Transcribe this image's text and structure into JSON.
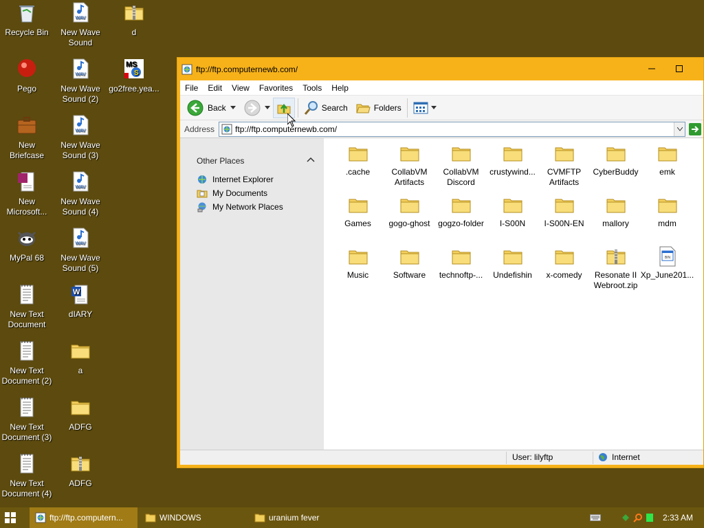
{
  "desktop": {
    "icons": [
      {
        "label": "Recycle Bin",
        "icon": "recycle-bin-icon"
      },
      {
        "label": "New Wave Sound",
        "icon": "wav-file-icon"
      },
      {
        "label": "d",
        "icon": "zip-folder-icon"
      },
      {
        "label": "Pego",
        "icon": "pego-app-icon"
      },
      {
        "label": "New Wave Sound (2)",
        "icon": "wav-file-icon"
      },
      {
        "label": "go2free.yea...",
        "icon": "msn-shortcut-icon"
      },
      {
        "label": "New Briefcase",
        "icon": "briefcase-icon"
      },
      {
        "label": "New Wave Sound (3)",
        "icon": "wav-file-icon"
      },
      {
        "label": "New Microsoft...",
        "icon": "ms-document-icon"
      },
      {
        "label": "New Wave Sound (4)",
        "icon": "wav-file-icon"
      },
      {
        "label": "MyPal 68",
        "icon": "mypal-browser-icon"
      },
      {
        "label": "New Wave Sound (5)",
        "icon": "wav-file-icon"
      },
      {
        "label": "New Text Document",
        "icon": "text-document-icon"
      },
      {
        "label": "dIARY",
        "icon": "word-document-icon"
      },
      {
        "label": "New Text Document (2)",
        "icon": "text-document-icon"
      },
      {
        "label": "a",
        "icon": "folder-icon"
      },
      {
        "label": "New Text Document (3)",
        "icon": "text-document-icon"
      },
      {
        "label": "ADFG",
        "icon": "folder-icon"
      },
      {
        "label": "New Text Document (4)",
        "icon": "text-document-icon"
      },
      {
        "label": "ADFG",
        "icon": "zip-folder-icon"
      }
    ]
  },
  "window": {
    "title": "ftp://ftp.computernewb.com/",
    "menu": [
      "File",
      "Edit",
      "View",
      "Favorites",
      "Tools",
      "Help"
    ],
    "toolbar": {
      "back": "Back",
      "search": "Search",
      "folders": "Folders"
    },
    "address": {
      "label": "Address",
      "value": "ftp://ftp.computernewb.com/"
    },
    "other_places": {
      "title": "Other Places",
      "items": [
        "Internet Explorer",
        "My Documents",
        "My Network Places"
      ]
    },
    "files": [
      {
        "name": ".cache",
        "type": "folder"
      },
      {
        "name": "CollabVM Artifacts",
        "type": "folder"
      },
      {
        "name": "CollabVM Discord",
        "type": "folder"
      },
      {
        "name": "crustywind...",
        "type": "folder"
      },
      {
        "name": "CVMFTP Artifacts",
        "type": "folder"
      },
      {
        "name": "CyberBuddy",
        "type": "folder"
      },
      {
        "name": "emk",
        "type": "folder"
      },
      {
        "name": "Games",
        "type": "folder"
      },
      {
        "name": "gogo-ghost",
        "type": "folder"
      },
      {
        "name": "gogzo-folder",
        "type": "folder"
      },
      {
        "name": "I-S00N",
        "type": "folder"
      },
      {
        "name": "I-S00N-EN",
        "type": "folder"
      },
      {
        "name": "mallory",
        "type": "folder"
      },
      {
        "name": "mdm",
        "type": "folder"
      },
      {
        "name": "Music",
        "type": "folder"
      },
      {
        "name": "Software",
        "type": "folder"
      },
      {
        "name": "technoftp-...",
        "type": "folder"
      },
      {
        "name": "Undefishin",
        "type": "folder"
      },
      {
        "name": "x-comedy",
        "type": "folder"
      },
      {
        "name": "Resonate II Webroot.zip",
        "type": "zip"
      },
      {
        "name": "Xp_June201...",
        "type": "file"
      }
    ],
    "status": {
      "user": "User: lilyftp",
      "zone": "Internet"
    }
  },
  "taskbar": {
    "tasks": [
      {
        "label": "ftp://ftp.computern...",
        "active": true
      },
      {
        "label": "WINDOWS",
        "active": false
      },
      {
        "label": "uranium fever",
        "active": false
      }
    ],
    "clock": "2:33 AM"
  },
  "colors": {
    "desktop": "#5c4a0e",
    "accent": "#f7b21a",
    "taskbar": "#6b560f"
  }
}
